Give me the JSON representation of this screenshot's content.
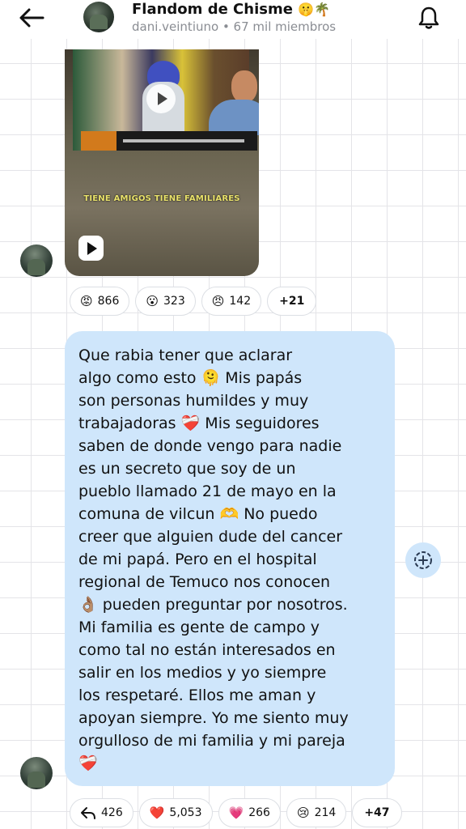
{
  "header": {
    "title": "Flandom de Chisme",
    "title_emoji": "🤫🌴",
    "subtitle": "dani.veintiuno • 67 mil miembros"
  },
  "video": {
    "caption": "TIENE AMIGOS TIENE FAMILIARES"
  },
  "reactions_top": [
    {
      "emoji": "😡",
      "count": "866"
    },
    {
      "emoji": "😮",
      "count": "323"
    },
    {
      "emoji": "😠",
      "count": "142"
    }
  ],
  "reactions_top_more": "+21",
  "message": {
    "lines": [
      "Que rabia tener que aclarar",
      "algo como esto 🫠 Mis papás",
      "son personas humildes y muy",
      "trabajadoras ❤️‍🩹 Mis seguidores",
      "saben de donde vengo para nadie",
      "es un secreto que soy de un",
      "pueblo llamado 21 de mayo en la",
      "comuna de vilcun 🫶 No puedo",
      "creer que alguien dude del cancer",
      "de mi papá. Pero en el hospital",
      "regional de Temuco nos conocen",
      "👌🏽 pueden preguntar por nosotros.",
      "Mi familia es gente de campo y",
      "como tal no están interesados en",
      "salir en los medios y yo siempre",
      "los respetaré. Ellos me aman y",
      "apoyan siempre. Yo me siento muy",
      "orgulloso de mi familia y mi pareja",
      "❤️‍🩹"
    ]
  },
  "reactions_bottom": {
    "reply_count": "426",
    "items": [
      {
        "emoji": "❤️",
        "count": "5,053"
      },
      {
        "emoji": "💗",
        "count": "266"
      },
      {
        "emoji": "😢",
        "count": "214"
      }
    ],
    "more": "+47"
  },
  "colors": {
    "bubble": "#cfe6fb",
    "subtitle": "#8a8d93",
    "caption": "#e9e26a"
  }
}
